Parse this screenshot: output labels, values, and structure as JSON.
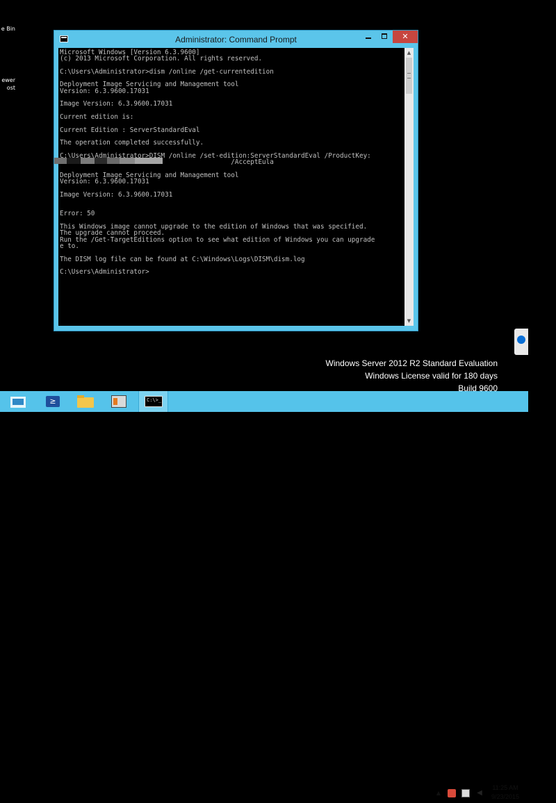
{
  "desktop": {
    "icons": [
      {
        "label": "e Bin"
      },
      {
        "label": "ewer"
      },
      {
        "label": "ost"
      }
    ]
  },
  "window": {
    "title": "Administrator: Command Prompt",
    "minimize_label": "",
    "maximize_label": "",
    "close_label": "✕"
  },
  "console": {
    "text": "Microsoft Windows [Version 6.3.9600]\n(c) 2013 Microsoft Corporation. All rights reserved.\n\nC:\\Users\\Administrator>dism /online /get-currentedition\n\nDeployment Image Servicing and Management tool\nVersion: 6.3.9600.17031\n\nImage Version: 6.3.9600.17031\n\nCurrent edition is:\n\nCurrent Edition : ServerStandardEval\n\nThe operation completed successfully.\n\nC:\\Users\\Administrator>DISM /online /set-edition:ServerStandardEval /ProductKey:\n                                            /AcceptEula\n\nDeployment Image Servicing and Management tool\nVersion: 6.3.9600.17031\n\nImage Version: 6.3.9600.17031\n\n\nError: 50\n\nThis Windows image cannot upgrade to the edition of Windows that was specified.\nThe upgrade cannot proceed.\nRun the /Get-TargetEditions option to see what edition of Windows you can upgrade\ne to.\n\nThe DISM log file can be found at C:\\Windows\\Logs\\DISM\\dism.log\n\nC:\\Users\\Administrator>"
  },
  "scrollbar": {
    "up_arrow": "▲",
    "down_arrow": "▼"
  },
  "watermark": {
    "line1": "Windows Server 2012 R2 Standard Evaluation",
    "line2": "Windows License valid for 180 days",
    "line3": "Build 9600"
  },
  "taskbar": {
    "powershell_glyph": "≥",
    "cmd_glyph": "C:\\>_"
  },
  "tray": {
    "chevron": "▲",
    "volume_glyph": "◀",
    "time": "11:25 AM",
    "date": "9/23/2015"
  }
}
